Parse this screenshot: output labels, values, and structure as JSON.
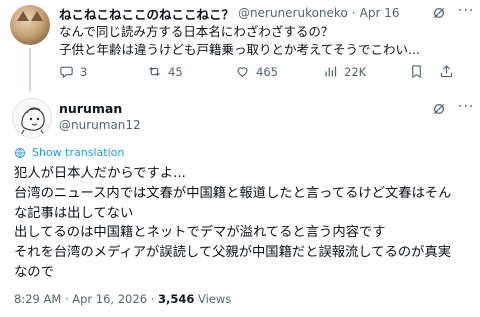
{
  "reply": {
    "display_name": "ねこねこねここのねここねこ？",
    "handle": "@nerunerukoneko",
    "separator": "·",
    "date": "Apr 16",
    "text_lines": [
      "なんで同じ読み方する日本名にわざわざするの？",
      "子供と年齢は違うけども戸籍乗っ取りとか考えてそうでこわい..."
    ],
    "actions": {
      "replies": "3",
      "retweets": "45",
      "likes": "465",
      "views": "22K"
    }
  },
  "tweet": {
    "display_name": "nuruman",
    "handle": "@nuruman12",
    "show_translation": "Show translation",
    "text_lines": [
      "犯人が日本人だからですよ...",
      "台湾のニュース内では文春が中国籍と報道したと言ってるけど文春はそん",
      "な記事は出してない",
      "出してるのは中国籍とネットでデマが溢れてると言う内容です",
      "それを台湾のメディアが誤読して父親が中国籍だと誤報流してるのが真実",
      "なので"
    ],
    "time": "8:29 AM",
    "date": "Apr 16, 2026",
    "views_count": "3,546",
    "views_label": "Views"
  },
  "colors": {
    "text": "#0f1419",
    "secondary": "#536471",
    "link": "#1d9bf0",
    "thread_line": "#cfd9de"
  },
  "icons": [
    "grok-icon",
    "more-icon",
    "reply-icon",
    "retweet-icon",
    "like-icon",
    "views-icon",
    "bookmark-icon",
    "share-icon",
    "globe-icon"
  ]
}
